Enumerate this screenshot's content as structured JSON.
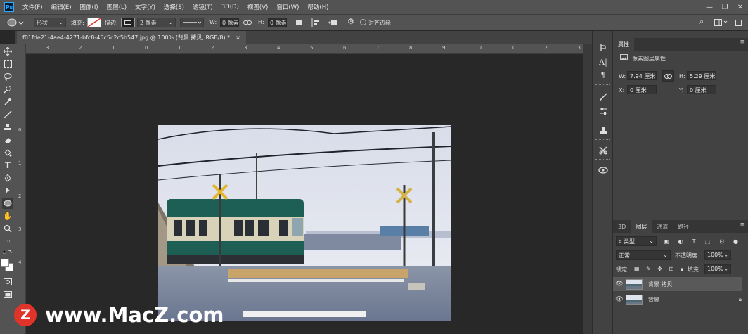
{
  "app": {
    "logo_text": "Ps"
  },
  "menu": [
    "文件(F)",
    "编辑(E)",
    "图像(I)",
    "图层(L)",
    "文字(Y)",
    "选择(S)",
    "滤镜(T)",
    "3D(D)",
    "视图(V)",
    "窗口(W)",
    "帮助(H)"
  ],
  "window_controls": {
    "minimize": "—",
    "restore": "❐",
    "close": "✕"
  },
  "options": {
    "shape_mode": "形状",
    "fill_label": "填充:",
    "stroke_label": "描边:",
    "stroke_width": "2 像素",
    "w_label": "W:",
    "w_value": "0 像素",
    "h_label": "H:",
    "h_value": "0 像素",
    "align_edges": "对齐边缘"
  },
  "document": {
    "tab_title": "f01fde21-4ae4-4271-bfc8-45c5c2c5b547.jpg @ 100% (背景 拷贝, RGB/8) *",
    "close": "×"
  },
  "rulers": {
    "h_ticks": [
      "3",
      "2",
      "1",
      "0",
      "1",
      "2",
      "3",
      "4",
      "5",
      "6",
      "7",
      "8",
      "9",
      "10",
      "11",
      "12",
      "13"
    ],
    "v_ticks": [
      "0",
      "1",
      "2",
      "3",
      "4"
    ]
  },
  "properties": {
    "tab": "属性",
    "type_label": "像素图层属性",
    "w_label": "W:",
    "w_value": "7.94 厘米",
    "h_label": "H:",
    "h_value": "5.29 厘米",
    "x_label": "X:",
    "x_value": "0 厘米",
    "y_label": "Y:",
    "y_value": "0 厘米"
  },
  "layers_panel": {
    "tabs": [
      "3D",
      "图层",
      "通道",
      "路径"
    ],
    "active_tab": "图层",
    "filter_kind": "类型",
    "blend_mode": "正常",
    "opacity_label": "不透明度:",
    "opacity_value": "100%",
    "lock_label": "锁定:",
    "fill_label": "填充:",
    "fill_value": "100%",
    "layers": [
      {
        "name": "背景 拷贝",
        "selected": true
      },
      {
        "name": "背景",
        "selected": false,
        "locked": true
      }
    ]
  },
  "watermark": {
    "logo_letter": "Z",
    "text": "www.MacZ.com"
  },
  "colors": {
    "selection_accent": "#e0342b",
    "ps_blue": "#31a8ff"
  }
}
